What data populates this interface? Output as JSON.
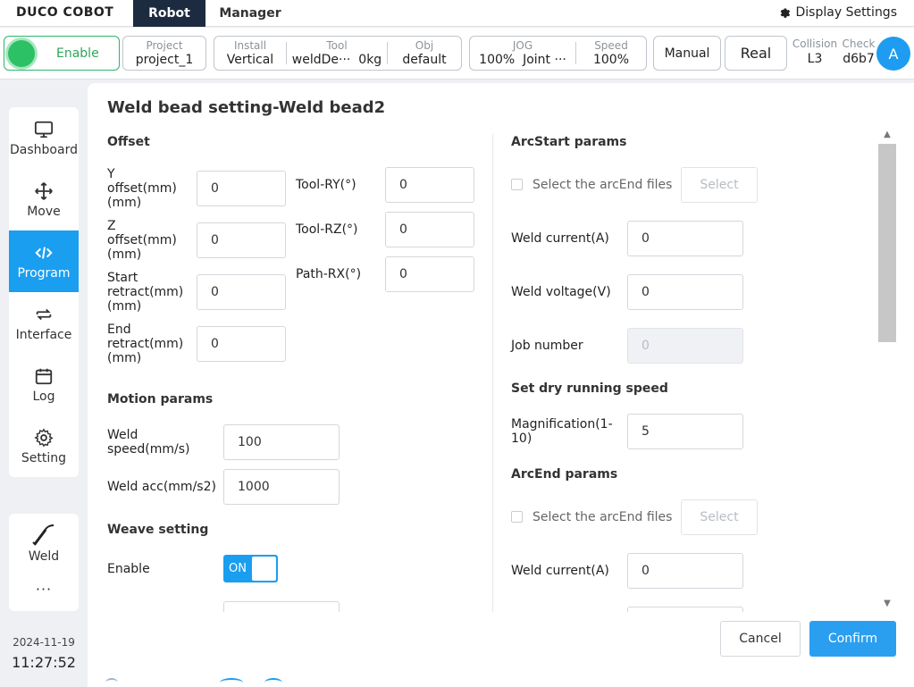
{
  "topbar": {
    "logo": "DUCO COBOT",
    "tabs": [
      "Robot",
      "Manager"
    ],
    "display_settings": "Display Settings"
  },
  "status": {
    "enable": "Enable",
    "project": {
      "label": "Project",
      "value": "project_1"
    },
    "install": {
      "label": "Install",
      "value": "Vertical"
    },
    "tool": {
      "label": "Tool",
      "value": "weldDe···",
      "weight": "0kg"
    },
    "obj": {
      "label": "Obj",
      "value": "default"
    },
    "jog": {
      "label": "JOG",
      "value": "100%",
      "mode": "Joint ···"
    },
    "speed": {
      "label": "Speed",
      "value": "100%"
    },
    "manual": "Manual",
    "real": "Real",
    "collision": {
      "label": "Collision",
      "value": "L3"
    },
    "check": {
      "label": "Check",
      "value": "d6b7"
    },
    "avatar": "A"
  },
  "nav": {
    "items": [
      {
        "label": "Dashboard",
        "icon": "monitor-icon"
      },
      {
        "label": "Move",
        "icon": "move-arrows-icon"
      },
      {
        "label": "Program",
        "icon": "code-icon"
      },
      {
        "label": "Interface",
        "icon": "swap-icon"
      },
      {
        "label": "Log",
        "icon": "calendar-icon"
      },
      {
        "label": "Setting",
        "icon": "gear-icon"
      }
    ],
    "active": "Program",
    "weld": "Weld",
    "more": "···"
  },
  "clock": {
    "date": "2024-11-19",
    "time": "11:27:52"
  },
  "dialog": {
    "title": "Weld bead setting-Weld bead2",
    "offset": {
      "heading": "Offset",
      "y_offset": {
        "label": "Y offset(mm)(mm)",
        "value": "0"
      },
      "z_offset": {
        "label": "Z offset(mm)(mm)",
        "value": "0"
      },
      "start_retract": {
        "label": "Start retract(mm)(mm)",
        "value": "0"
      },
      "end_retract": {
        "label": "End retract(mm)(mm)",
        "value": "0"
      },
      "tool_ry": {
        "label": "Tool-RY(°)",
        "value": "0"
      },
      "tool_rz": {
        "label": "Tool-RZ(°)",
        "value": "0"
      },
      "path_rx": {
        "label": "Path-RX(°)",
        "value": "0"
      }
    },
    "motion": {
      "heading": "Motion params",
      "weld_speed": {
        "label": "Weld speed(mm/s)",
        "value": "100"
      },
      "weld_acc": {
        "label": "Weld acc(mm/s2)",
        "value": "1000"
      }
    },
    "weave": {
      "heading": "Weave setting",
      "enable_label": "Enable",
      "toggle_text": "ON"
    },
    "arcstart": {
      "heading": "ArcStart params",
      "file_check": "Select the arcEnd files",
      "select": "Select",
      "weld_current": {
        "label": "Weld current(A)",
        "value": "0"
      },
      "weld_voltage": {
        "label": "Weld voltage(V)",
        "value": "0"
      },
      "job_number": {
        "label": "Job number",
        "value": "0"
      }
    },
    "dry_run": {
      "heading": "Set dry running speed",
      "magnification": {
        "label": "Magnification(1-10)",
        "value": "5"
      }
    },
    "arcend": {
      "heading": "ArcEnd params",
      "file_check": "Select the arcEnd files",
      "select": "Select",
      "weld_current": {
        "label": "Weld current(A)",
        "value": "0"
      }
    },
    "cancel": "Cancel",
    "confirm": "Confirm"
  },
  "colors": {
    "accent": "#1a9ef0",
    "nav_dark": "#1c2b3f",
    "enable_green": "#2bc164"
  }
}
